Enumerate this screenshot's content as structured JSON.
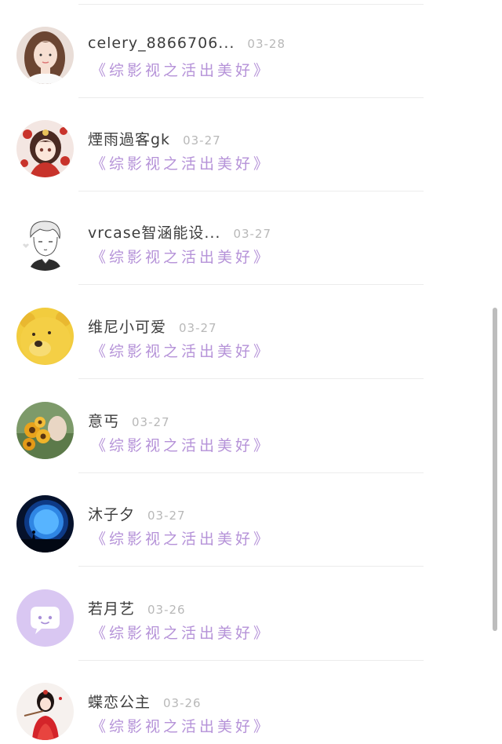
{
  "comments": [
    {
      "name": "celery_8866706...",
      "date": "03-28",
      "text": "《综影视之活出美好》",
      "avatar": "girl-portrait-avatar"
    },
    {
      "name": "煙雨過客gk",
      "date": "03-27",
      "text": "《综影视之活出美好》",
      "avatar": "anime-girl-avatar"
    },
    {
      "name": "vrcase智涵能设...",
      "date": "03-27",
      "text": "《综影视之活出美好》",
      "avatar": "sketch-boy-avatar"
    },
    {
      "name": "维尼小可爱",
      "date": "03-27",
      "text": "《综影视之活出美好》",
      "avatar": "winnie-bear-avatar"
    },
    {
      "name": "意丐",
      "date": "03-27",
      "text": "《综影视之活出美好》",
      "avatar": "sunflower-avatar"
    },
    {
      "name": "沐子夕",
      "date": "03-27",
      "text": "《综影视之活出美好》",
      "avatar": "blue-moon-avatar"
    },
    {
      "name": "若月艺",
      "date": "03-26",
      "text": "《综影视之活出美好》",
      "avatar": "default-chat-avatar"
    },
    {
      "name": "蝶恋公主",
      "date": "03-26",
      "text": "《综影视之活出美好》",
      "avatar": "red-dress-girl-avatar"
    }
  ],
  "colors": {
    "name": "#3d3d3d",
    "date": "#b8b8b8",
    "subtitle": "#b592d8",
    "default_avatar_bg": "#d9c7f2"
  }
}
